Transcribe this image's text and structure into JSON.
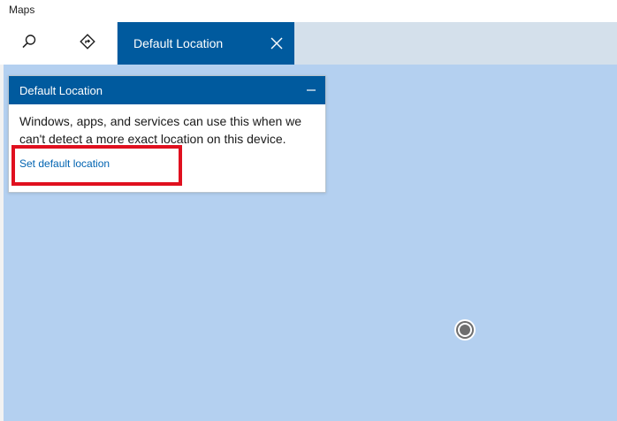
{
  "app": {
    "title": "Maps"
  },
  "toolbar": {
    "search_icon": "search-icon",
    "directions_icon": "directions-icon",
    "active_tab_label": "Default Location",
    "close_icon": "close-icon"
  },
  "panel": {
    "title": "Default Location",
    "collapse_icon": "minimize-icon",
    "description": "Windows, apps, and services can use this when we can't detect a more exact location on this device.",
    "link_label": "Set default location"
  },
  "map": {
    "location_marker": "current-location-icon"
  },
  "colors": {
    "accent": "#005a9e",
    "map_water": "#b4d0f0",
    "link": "#0063b1",
    "highlight": "#e0101f"
  }
}
